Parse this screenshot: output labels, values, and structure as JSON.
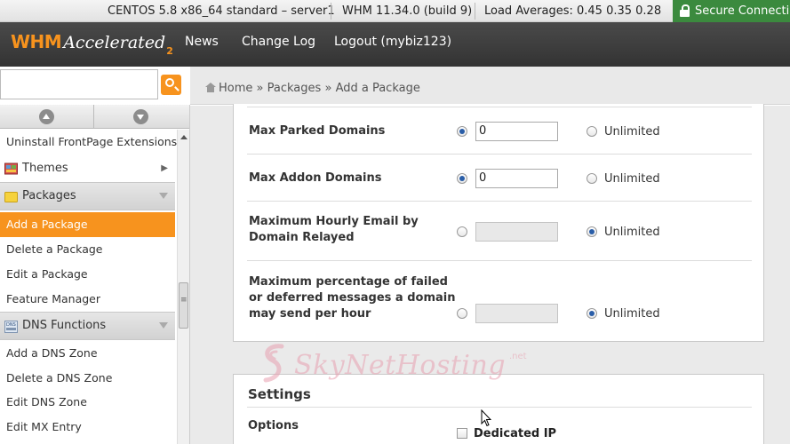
{
  "status_bar": {
    "os": "CENTOS 5.8 x86_64 standard – server1",
    "version": "WHM 11.34.0 (build 9)",
    "load": "Load Averages: 0.45 0.35 0.28",
    "secure": "Secure Connection"
  },
  "header": {
    "logo_whm": "WHM",
    "logo_accelerated": "Accelerated",
    "logo_2": "2",
    "nav": [
      "News",
      "Change Log",
      "Logout (mybiz123)"
    ]
  },
  "breadcrumb": {
    "home": "Home",
    "sep": "»",
    "packages": "Packages",
    "current": "Add a Package"
  },
  "sidebar": {
    "items": [
      {
        "label": "Uninstall FrontPage Extensions"
      },
      {
        "label": "Themes",
        "icon": "themes-icon"
      },
      {
        "label": "Packages",
        "icon": "packages-icon"
      },
      {
        "label": "Add a Package",
        "active": true
      },
      {
        "label": "Delete a Package"
      },
      {
        "label": "Edit a Package"
      },
      {
        "label": "Feature Manager"
      },
      {
        "label": "DNS Functions",
        "icon": "dns-icon"
      },
      {
        "label": "Add a DNS Zone"
      },
      {
        "label": "Delete a DNS Zone"
      },
      {
        "label": "Edit DNS Zone"
      },
      {
        "label": "Edit MX Entry"
      }
    ]
  },
  "form": {
    "rows": [
      {
        "label_lines": [
          "Max Parked Domains"
        ],
        "value": "0",
        "limited": true,
        "unlimited_label": "Unlimited"
      },
      {
        "label_lines": [
          "Max Addon Domains"
        ],
        "value": "0",
        "limited": true,
        "unlimited_label": "Unlimited"
      },
      {
        "label_lines": [
          "Maximum Hourly Email by",
          "Domain Relayed"
        ],
        "value": "",
        "limited": false,
        "unlimited_label": "Unlimited"
      },
      {
        "label_lines": [
          "Maximum percentage of failed",
          "or deferred messages a domain",
          "may send per hour"
        ],
        "value": "",
        "limited": false,
        "unlimited_label": "Unlimited"
      }
    ],
    "settings_title": "Settings",
    "options_label": "Options",
    "dedicated_ip_label": "Dedicated IP",
    "dedicated_ip_checked": false
  },
  "watermark": {
    "text": "SkyNetHosting",
    "suffix": ".net"
  },
  "colors": {
    "accent": "#f7931e",
    "secure_green": "#3b8a3e",
    "header_dark": "#3a3a3a"
  }
}
